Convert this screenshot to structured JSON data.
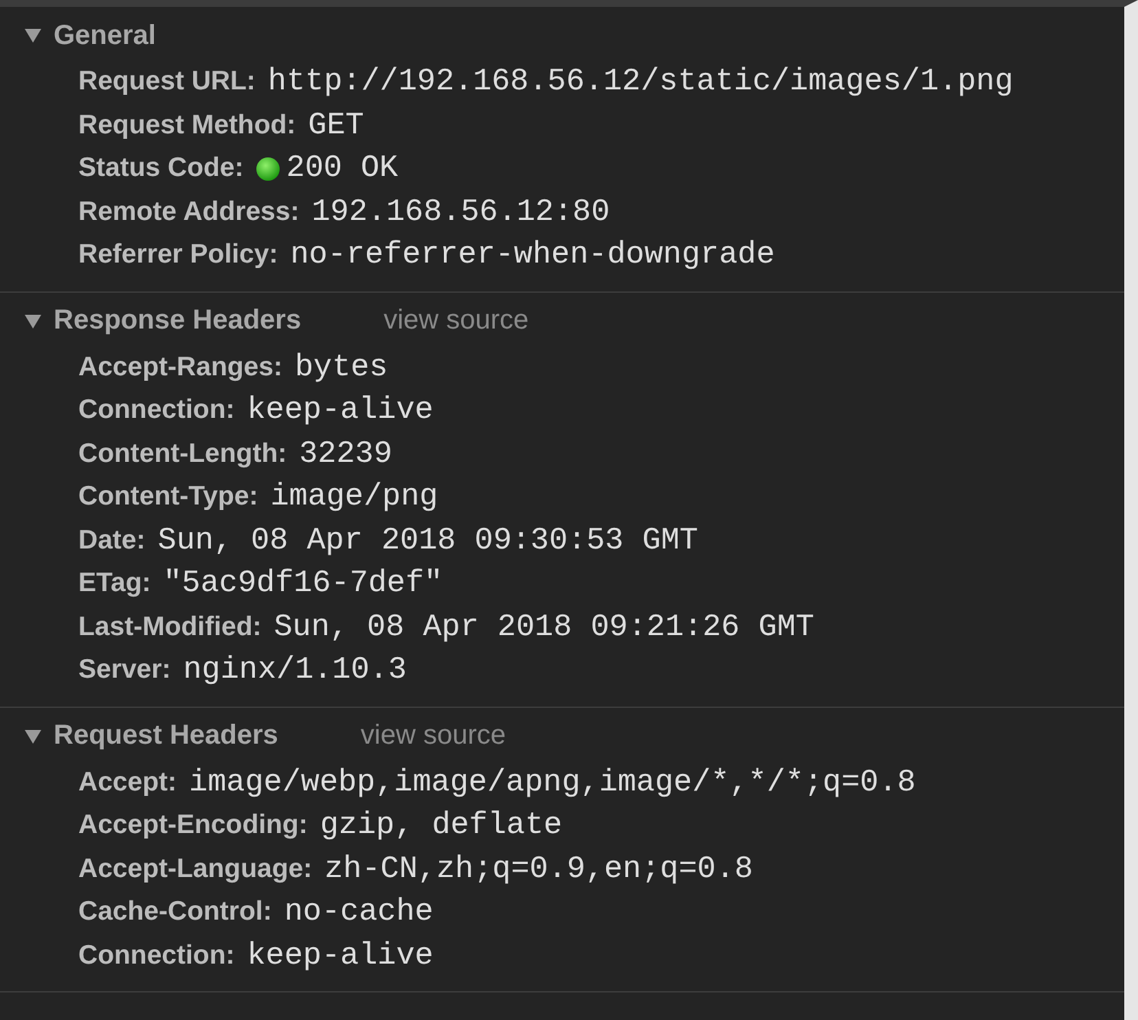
{
  "sections": [
    {
      "title": "General",
      "expanded": true,
      "rows": [
        {
          "name": "Request URL:",
          "value": "http://192.168.56.12/static/images/1.png"
        },
        {
          "name": "Request Method:",
          "value": "GET"
        },
        {
          "name": "Status Code:",
          "value": "200 OK",
          "kind": "status"
        },
        {
          "name": "Remote Address:",
          "value": "192.168.56.12:80"
        },
        {
          "name": "Referrer Policy:",
          "value": "no-referrer-when-downgrade"
        }
      ]
    },
    {
      "title": "Response Headers",
      "expanded": true,
      "link": "view source",
      "rows": [
        {
          "name": "Accept-Ranges:",
          "value": "bytes"
        },
        {
          "name": "Connection:",
          "value": "keep-alive"
        },
        {
          "name": "Content-Length:",
          "value": "32239"
        },
        {
          "name": "Content-Type:",
          "value": "image/png"
        },
        {
          "name": "Date:",
          "value": "Sun, 08 Apr 2018 09:30:53 GMT"
        },
        {
          "name": "ETag:",
          "value": "\"5ac9df16-7def\""
        },
        {
          "name": "Last-Modified:",
          "value": "Sun, 08 Apr 2018 09:21:26 GMT"
        },
        {
          "name": "Server:",
          "value": "nginx/1.10.3"
        }
      ]
    },
    {
      "title": "Request Headers",
      "expanded": true,
      "link": "view source",
      "rows": [
        {
          "name": "Accept:",
          "value": "image/webp,image/apng,image/*,*/*;q=0.8"
        },
        {
          "name": "Accept-Encoding:",
          "value": "gzip, deflate"
        },
        {
          "name": "Accept-Language:",
          "value": "zh-CN,zh;q=0.9,en;q=0.8"
        },
        {
          "name": "Cache-Control:",
          "value": "no-cache"
        },
        {
          "name": "Connection:",
          "value": "keep-alive"
        }
      ]
    }
  ]
}
